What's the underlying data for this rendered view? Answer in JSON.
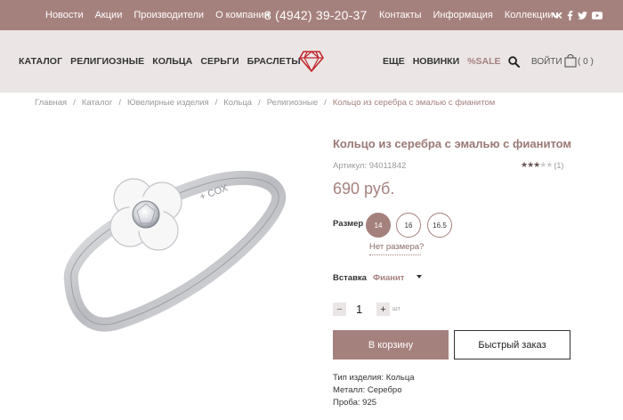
{
  "topbar": {
    "nav_left": [
      "Новости",
      "Акции",
      "Производители",
      "О компании"
    ],
    "phone": "8 (4942) 39-20-37",
    "nav_right": [
      "Контакты",
      "Информация",
      "Коллекции"
    ],
    "social_icons": [
      "vk-icon",
      "facebook-icon",
      "twitter-icon",
      "youtube-icon"
    ]
  },
  "mainnav": {
    "categories_left": [
      "КАТАЛОГ",
      "РЕЛИГИОЗНЫЕ",
      "КОЛЬЦА",
      "СЕРЬГИ",
      "БРАСЛЕТЫ"
    ],
    "categories_right": [
      "ЕЩЕ",
      "НОВИНКИ"
    ],
    "sale": "%SALE",
    "login": "ВОЙТИ",
    "cart_count": "( 0 )"
  },
  "breadcrumb": {
    "items": [
      "Главная",
      "Каталог",
      "Ювелирные изделия",
      "Кольца",
      "Религиозные"
    ],
    "current": "Кольцо из серебра с эмалью с фианитом"
  },
  "product": {
    "title": "Кольцо из серебра с эмалью с фианитом",
    "article": "Артикул: 94011842",
    "rating_value": 3,
    "rating_max": 5,
    "rating_count": "(1)",
    "price": "690 руб.",
    "size_label": "Размер",
    "sizes": [
      "14",
      "16",
      "16.5"
    ],
    "selected_size": "14",
    "no_size": "Нет размера?",
    "insert_label": "Вставка",
    "insert_value": "Фианит",
    "quantity": "1",
    "qty_minus": "−",
    "qty_plus": "+",
    "qty_unit": "шт",
    "add_to_cart": "В корзину",
    "quick_order": "Быстрый заказ",
    "specs": [
      "Тип изделия: Кольца",
      "Металл: Серебро",
      "Проба: 925"
    ],
    "engraving_text": "+ СОХ"
  },
  "colors": {
    "brand": "#a5817e",
    "nav_bg": "#ebe6e5"
  }
}
